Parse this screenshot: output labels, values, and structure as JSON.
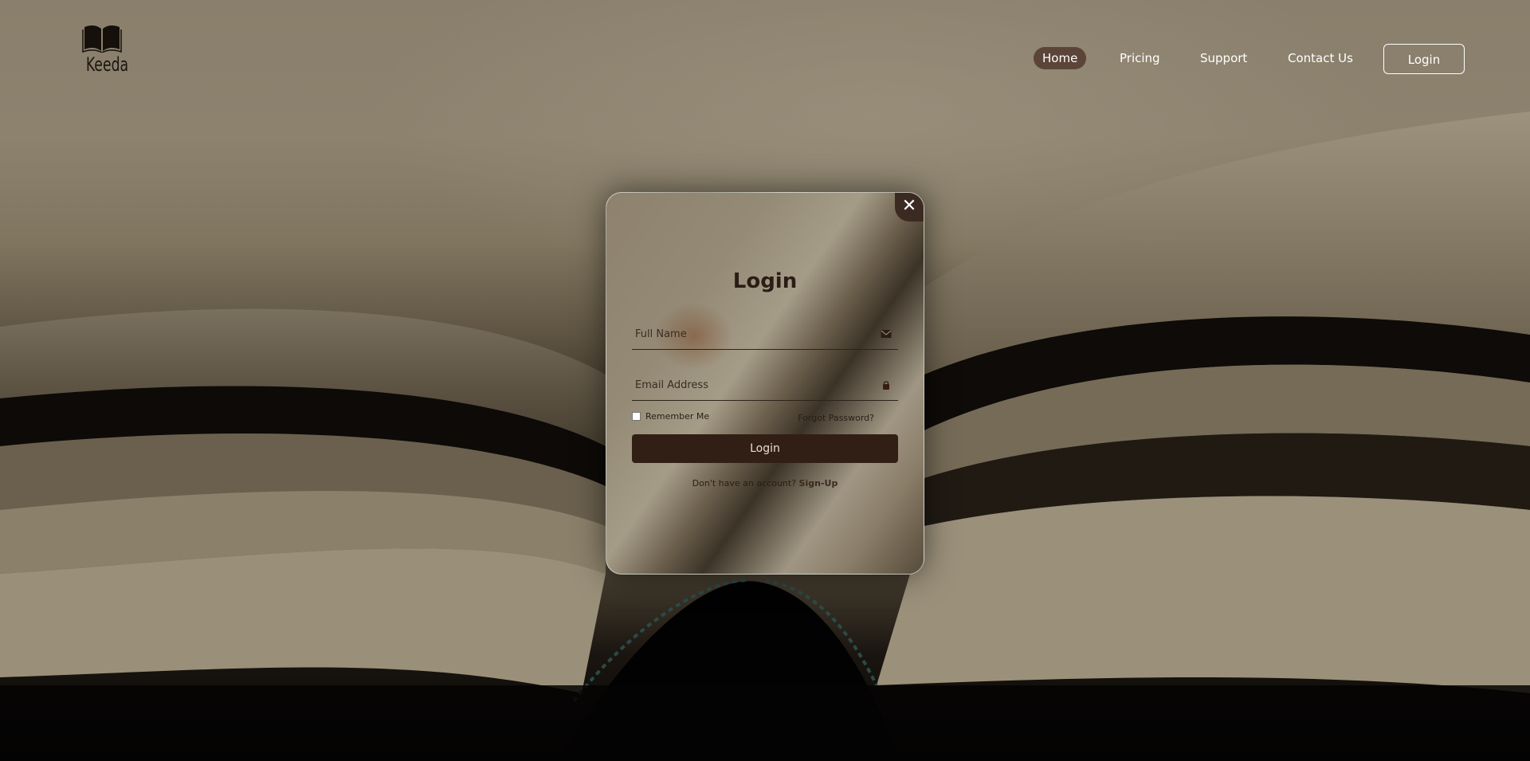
{
  "brand": {
    "name": "Keeda",
    "logo_icon": "open-book-icon"
  },
  "nav": {
    "items": [
      {
        "label": "Home",
        "active": true
      },
      {
        "label": "Pricing",
        "active": false
      },
      {
        "label": "Support",
        "active": false
      },
      {
        "label": "Contact Us",
        "active": false
      }
    ],
    "login_label": "Login"
  },
  "modal": {
    "close_icon": "close-icon",
    "title": "Login",
    "full_name_placeholder": "Full Name",
    "full_name_icon": "envelope-icon",
    "email_placeholder": "Email Address",
    "email_icon": "lock-icon",
    "remember_label": "Remember Me",
    "remember_checked": false,
    "forgot_label": "Forgot Password?",
    "submit_label": "Login",
    "signup_prompt": "Don't have an account?",
    "signup_link": "Sign-Up"
  },
  "colors": {
    "accent_dark": "#311f16",
    "nav_active_bg": "#5b4538",
    "text_dark": "#2b1d15"
  }
}
